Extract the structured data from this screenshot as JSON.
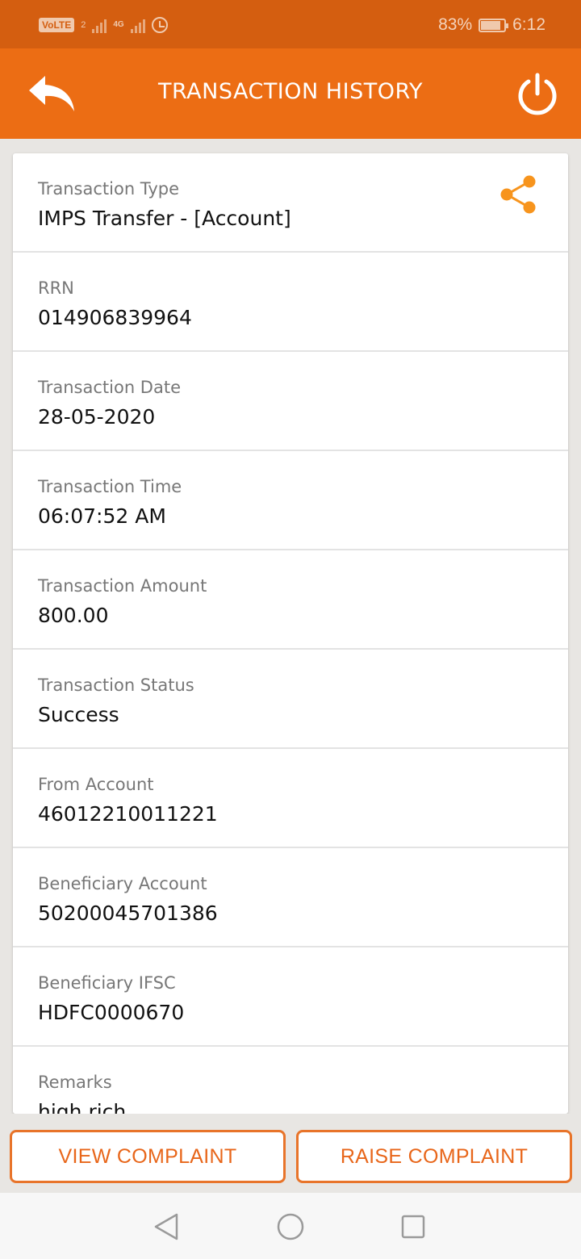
{
  "status_bar": {
    "volte": "VoLTE",
    "sim": "2",
    "network": "4G",
    "battery": "83%",
    "time": "6:12"
  },
  "header": {
    "title": "TRANSACTION HISTORY"
  },
  "details": [
    {
      "label": "Transaction Type",
      "value": "IMPS Transfer - [Account]"
    },
    {
      "label": "RRN",
      "value": "014906839964"
    },
    {
      "label": "Transaction Date",
      "value": "28-05-2020"
    },
    {
      "label": "Transaction Time",
      "value": "06:07:52 AM"
    },
    {
      "label": "Transaction Amount",
      "value": "800.00"
    },
    {
      "label": "Transaction Status",
      "value": "Success"
    },
    {
      "label": "From Account",
      "value": "46012210011221"
    },
    {
      "label": "Beneficiary Account",
      "value": "50200045701386"
    },
    {
      "label": "Beneficiary IFSC",
      "value": "HDFC0000670"
    },
    {
      "label": "Remarks",
      "value": "high rich"
    }
  ],
  "actions": {
    "view_label": "VIEW COMPLAINT",
    "raise_label": "RAISE COMPLAINT"
  },
  "icons": {
    "back": "back-arrow-icon",
    "power": "power-icon",
    "share": "share-icon",
    "nav_back": "triangle-back-icon",
    "nav_home": "circle-home-icon",
    "nav_recent": "square-recents-icon"
  },
  "colors": {
    "status_bar": "#d45e10",
    "header": "#ec6d14",
    "accent": "#e8742a",
    "share": "#f7941d"
  }
}
